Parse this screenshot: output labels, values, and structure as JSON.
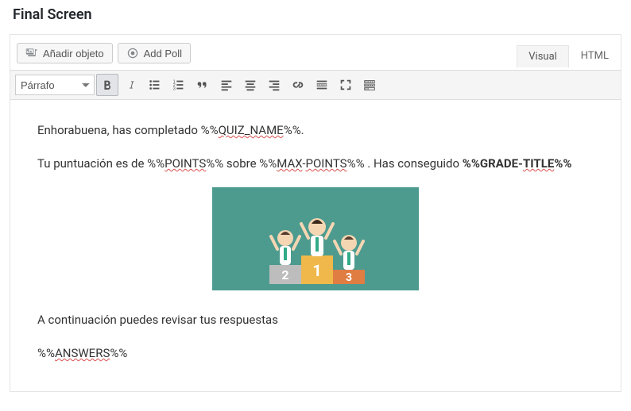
{
  "heading": "Final Screen",
  "buttons": {
    "add_media": "Añadir objeto",
    "add_poll": "Add Poll"
  },
  "tabs": {
    "visual": "Visual",
    "html": "HTML"
  },
  "toolbar": {
    "format": "Párrafo"
  },
  "content": {
    "p1_a": "Enhorabuena, has completado %%",
    "p1_quiz": "QUIZ_NAME",
    "p1_b": "%%.",
    "p2_a": "Tu puntuación es de %%",
    "p2_points": "POINTS",
    "p2_b": "%% sobre %%",
    "p2_max": "MAX",
    "p2_dash": "-",
    "p2_maxp2": "POINTS",
    "p2_c": "%% . Has conseguido ",
    "p2_grade_a": "%%GRADE-",
    "p2_title": "TITLE",
    "p2_grade_b": "%%",
    "p3": "A continuación puedes revisar tus respuestas",
    "p4_a": "%%",
    "p4_ans": "ANSWERS",
    "p4_b": "%%"
  }
}
